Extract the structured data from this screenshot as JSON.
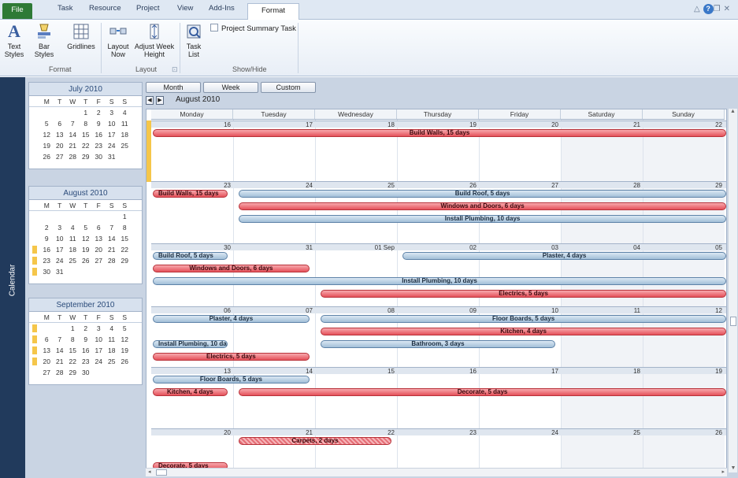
{
  "ribbon_tabs": {
    "file": "File",
    "task": "Task",
    "resource": "Resource",
    "project": "Project",
    "view": "View",
    "addins": "Add-Ins",
    "format": "Format"
  },
  "ribbon": {
    "text_styles": "Text Styles",
    "bar_styles": "Bar Styles",
    "gridlines": "Gridlines",
    "layout_now": "Layout Now",
    "adjust_week_height": "Adjust Week Height",
    "task_list": "Task List",
    "project_summary_task": "Project Summary Task",
    "group_format": "Format",
    "group_layout": "Layout",
    "group_showhide": "Show/Hide"
  },
  "sidebar_label": "Calendar",
  "view_buttons": {
    "month": "Month",
    "week": "Week",
    "custom": "Custom"
  },
  "current_month": "August 2010",
  "day_headers": [
    "Monday",
    "Tuesday",
    "Wednesday",
    "Thursday",
    "Friday",
    "Saturday",
    "Sunday"
  ],
  "mini_calendars": [
    {
      "title": "July 2010",
      "days": [
        "M",
        "T",
        "W",
        "T",
        "F",
        "S",
        "S"
      ],
      "weeks": [
        [
          "",
          "",
          "",
          "1",
          "2",
          "3",
          "4"
        ],
        [
          "5",
          "6",
          "7",
          "8",
          "9",
          "10",
          "11"
        ],
        [
          "12",
          "13",
          "14",
          "15",
          "16",
          "17",
          "18"
        ],
        [
          "19",
          "20",
          "21",
          "22",
          "23",
          "24",
          "25"
        ],
        [
          "26",
          "27",
          "28",
          "29",
          "30",
          "31",
          ""
        ]
      ],
      "marked": []
    },
    {
      "title": "August 2010",
      "days": [
        "M",
        "T",
        "W",
        "T",
        "F",
        "S",
        "S"
      ],
      "weeks": [
        [
          "",
          "",
          "",
          "",
          "",
          "",
          "1"
        ],
        [
          "2",
          "3",
          "4",
          "5",
          "6",
          "7",
          "8"
        ],
        [
          "9",
          "10",
          "11",
          "12",
          "13",
          "14",
          "15"
        ],
        [
          "16",
          "17",
          "18",
          "19",
          "20",
          "21",
          "22"
        ],
        [
          "23",
          "24",
          "25",
          "26",
          "27",
          "28",
          "29"
        ],
        [
          "30",
          "31",
          "",
          "",
          "",
          "",
          ""
        ]
      ],
      "marked": [
        3,
        4,
        5
      ]
    },
    {
      "title": "September 2010",
      "days": [
        "M",
        "T",
        "W",
        "T",
        "F",
        "S",
        "S"
      ],
      "weeks": [
        [
          "",
          "",
          "1",
          "2",
          "3",
          "4",
          "5"
        ],
        [
          "6",
          "7",
          "8",
          "9",
          "10",
          "11",
          "12"
        ],
        [
          "13",
          "14",
          "15",
          "16",
          "17",
          "18",
          "19"
        ],
        [
          "20",
          "21",
          "22",
          "23",
          "24",
          "25",
          "26"
        ],
        [
          "27",
          "28",
          "29",
          "30",
          "",
          "",
          ""
        ]
      ],
      "marked": [
        0,
        1,
        2,
        3
      ]
    }
  ],
  "weeks": [
    {
      "nums": [
        "16",
        "17",
        "18",
        "19",
        "20",
        "21",
        "22"
      ]
    },
    {
      "nums": [
        "23",
        "24",
        "25",
        "26",
        "27",
        "28",
        "29"
      ]
    },
    {
      "nums": [
        "30",
        "31",
        "01 Sep",
        "02",
        "03",
        "04",
        "05"
      ]
    },
    {
      "nums": [
        "06",
        "07",
        "08",
        "09",
        "10",
        "11",
        "12"
      ]
    },
    {
      "nums": [
        "13",
        "14",
        "15",
        "16",
        "17",
        "18",
        "19"
      ]
    },
    {
      "nums": [
        "20",
        "21",
        "22",
        "23",
        "24",
        "25",
        "26"
      ]
    }
  ],
  "tasks": {
    "build_walls": "Build Walls, 15 days",
    "build_roof": "Build Roof, 5 days",
    "windows_doors": "Windows and Doors, 6 days",
    "install_plumbing": "Install Plumbing, 10 days",
    "plaster": "Plaster, 4 days",
    "electrics": "Electrics, 5 days",
    "floor_boards": "Floor Boards, 5 days",
    "kitchen": "Kitchen, 4 days",
    "bathroom": "Bathroom, 3 days",
    "decorate": "Decorate, 5 days",
    "carpets": "Carpets, 2 days"
  },
  "colors": {
    "critical": "#e5515a",
    "normal": "#a2bfd8",
    "today": "#f5c64a",
    "sidebar": "#213a5c"
  }
}
